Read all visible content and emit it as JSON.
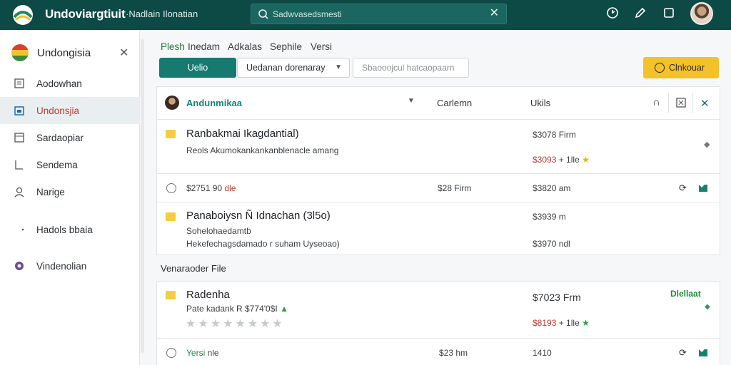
{
  "topbar": {
    "title": "Undoviargtiuit",
    "subtitle": "·Nadlain Ilonatian",
    "search_placeholder": "Sadwvasedsmesti",
    "clear": "✕"
  },
  "sidebar": {
    "header": "Undongisia",
    "close": "✕",
    "items": [
      {
        "label": "Aodowhan",
        "icon": "list-icon"
      },
      {
        "label": "Undonsjia",
        "icon": "calendar-icon",
        "active": true
      },
      {
        "label": "Sardaopiar",
        "icon": "document-icon"
      },
      {
        "label": "Sendema",
        "icon": "bookmark-icon"
      },
      {
        "label": "Narige",
        "icon": "user-icon"
      },
      {
        "label": "Hadols bbaia",
        "icon": "dot-icon"
      },
      {
        "label": "Vindenolian",
        "icon": "vault-icon"
      }
    ]
  },
  "tabs": [
    "Plesh",
    "Inedam",
    "Adkalas",
    "Sephile",
    "Versi"
  ],
  "toolbar": {
    "primary": "Uelio",
    "select_value": "Uedanan dorenaray",
    "filter_placeholder": "Sbaooojcul hatcaopaarn",
    "accent": "Clnkouar"
  },
  "list_header": {
    "name": "Andunmikaa",
    "col2": "Carlemn",
    "col3": "Ukils"
  },
  "rows": [
    {
      "title": "Ranbakmai Ikagdantial)",
      "sub": "Reols Akumokankankanblenacle amang",
      "col3": "$3078 Firm",
      "price": "$3093",
      "price_suffix": "+ 1lle",
      "star": "★"
    },
    {
      "label": "$2751 90",
      "label_suffix": "dle",
      "col2": "$28 Firm",
      "col3": "$3820 am"
    },
    {
      "title": "Panaboiysn Ñ Idnachan (3l5o)",
      "sub1": "Sohelohaedamtb",
      "sub2": "Hekefechagsdamado r suham Uyseoao)",
      "col3a": "$3939 m",
      "col3b": "$3970 ndl"
    }
  ],
  "section_label": "Venaraoder File",
  "rows2": [
    {
      "title": "Radenha",
      "sub": "Pate kadank R $774'0$I",
      "stars": "★★★★★★★★",
      "price_main": "$7023 Frm",
      "price": "$8193",
      "price_suffix": "+ 1lle",
      "status": "Dlellaat",
      "star": "★"
    },
    {
      "label": "Yersi",
      "label_suffix": "nle",
      "col2": "$23 hm",
      "col3": "1410"
    }
  ]
}
